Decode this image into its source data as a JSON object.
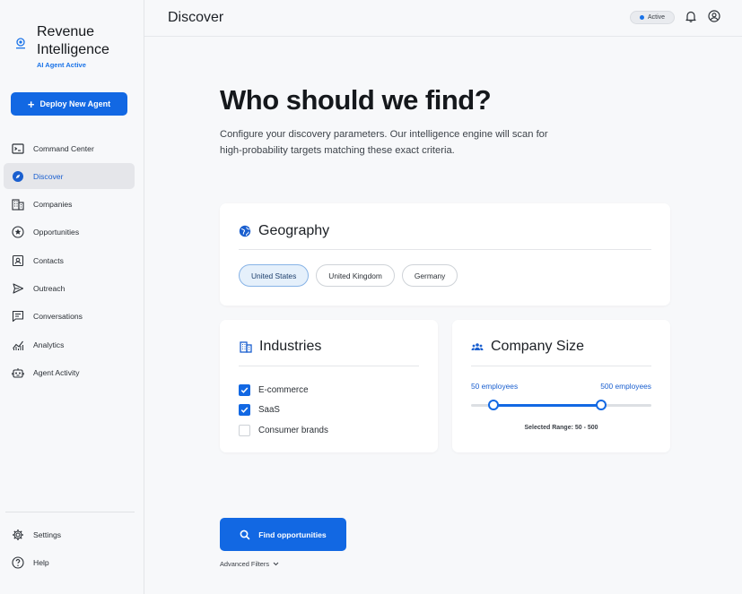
{
  "brand": {
    "title_line1": "Revenue",
    "title_line2": "Intelligence",
    "subtitle": "AI Agent Active"
  },
  "deploy_button": {
    "label": "Deploy New Agent"
  },
  "nav": [
    {
      "label": "Command Center",
      "icon": "terminal-icon"
    },
    {
      "label": "Discover",
      "icon": "compass-icon",
      "active": true
    },
    {
      "label": "Companies",
      "icon": "building-icon"
    },
    {
      "label": "Opportunities",
      "icon": "star-icon"
    },
    {
      "label": "Contacts",
      "icon": "contact-card-icon"
    },
    {
      "label": "Outreach",
      "icon": "send-icon"
    },
    {
      "label": "Conversations",
      "icon": "chat-icon"
    },
    {
      "label": "Analytics",
      "icon": "chart-icon"
    },
    {
      "label": "Agent Activity",
      "icon": "robot-icon"
    }
  ],
  "nav_bottom": [
    {
      "label": "Settings",
      "icon": "gear-icon"
    },
    {
      "label": "Help",
      "icon": "help-icon"
    }
  ],
  "header": {
    "title": "Discover",
    "status": "Active"
  },
  "hero": {
    "title": "Who should we find?",
    "description": "Configure your discovery parameters. Our intelligence engine will scan for high-probability targets matching these exact criteria."
  },
  "geography": {
    "title": "Geography",
    "options": [
      {
        "label": "United States",
        "selected": true
      },
      {
        "label": "United Kingdom",
        "selected": false
      },
      {
        "label": "Germany",
        "selected": false
      }
    ]
  },
  "industries": {
    "title": "Industries",
    "options": [
      {
        "label": "E-commerce",
        "checked": true
      },
      {
        "label": "SaaS",
        "checked": true
      },
      {
        "label": "Consumer brands",
        "checked": false
      }
    ]
  },
  "company_size": {
    "title": "Company Size",
    "min_label": "50 employees",
    "max_label": "500 employees",
    "range_min_fraction": 0.125,
    "range_max_fraction": 0.72,
    "caption": "Selected Range: 50 - 500"
  },
  "find_button": {
    "label": "Find opportunities"
  },
  "advanced_filters": {
    "label": "Advanced Filters"
  },
  "colors": {
    "accent": "#1268e3",
    "active_nav_text": "#1a5fcf",
    "background": "#f7f8fa"
  }
}
